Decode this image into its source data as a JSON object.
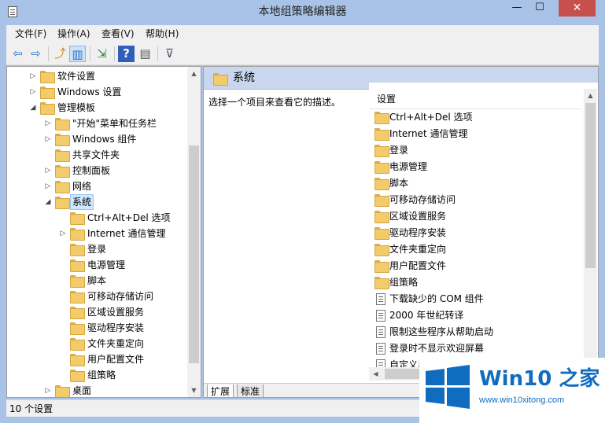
{
  "window": {
    "title": "本地组策略编辑器",
    "min_glyph": "—",
    "max_glyph": "☐",
    "close_glyph": "✕"
  },
  "menu": [
    "文件(F)",
    "操作(A)",
    "查看(V)",
    "帮助(H)"
  ],
  "toolbar": {
    "icons": [
      "back-arrow-icon",
      "forward-arrow-icon",
      "up-folder-icon",
      "show-hide-tree-icon",
      "export-list-icon",
      "help-icon",
      "properties-pane-icon",
      "filter-icon"
    ],
    "glyphs": [
      "⇦",
      "⇨",
      "⤴",
      "▥",
      "⇲",
      "?",
      "▤",
      "⊽"
    ]
  },
  "tree": {
    "items": [
      {
        "label": "软件设置",
        "expander": "▷"
      },
      {
        "label": "Windows 设置",
        "expander": "▷"
      },
      {
        "label": "管理模板",
        "expander": "◢"
      },
      {
        "label": "\"开始\"菜单和任务栏",
        "expander": "▷"
      },
      {
        "label": "Windows 组件",
        "expander": "▷"
      },
      {
        "label": "共享文件夹",
        "expander": ""
      },
      {
        "label": "控制面板",
        "expander": "▷"
      },
      {
        "label": "网络",
        "expander": "▷"
      },
      {
        "label": "系统",
        "expander": "◢"
      },
      {
        "label": "Ctrl+Alt+Del 选项",
        "expander": ""
      },
      {
        "label": "Internet 通信管理",
        "expander": "▷"
      },
      {
        "label": "登录",
        "expander": ""
      },
      {
        "label": "电源管理",
        "expander": ""
      },
      {
        "label": "脚本",
        "expander": ""
      },
      {
        "label": "可移动存储访问",
        "expander": ""
      },
      {
        "label": "区域设置服务",
        "expander": ""
      },
      {
        "label": "驱动程序安装",
        "expander": ""
      },
      {
        "label": "文件夹重定向",
        "expander": ""
      },
      {
        "label": "用户配置文件",
        "expander": ""
      },
      {
        "label": "组策略",
        "expander": ""
      },
      {
        "label": "桌面",
        "expander": "▷"
      }
    ],
    "selected": "系统"
  },
  "scroll": {
    "up": "▲",
    "down": "▼",
    "left": "◀",
    "right": "▶"
  },
  "details": {
    "title": "系统",
    "description": "选择一个项目来查看它的描述。",
    "column_header": "设置",
    "folders": [
      "Ctrl+Alt+Del 选项",
      "Internet 通信管理",
      "登录",
      "电源管理",
      "脚本",
      "可移动存储访问",
      "区域设置服务",
      "驱动程序安装",
      "文件夹重定向",
      "用户配置文件",
      "组策略"
    ],
    "settings": [
      "下载缺少的 COM 组件",
      "2000 年世纪转译",
      "限制这些程序从帮助启动",
      "登录时不显示欢迎屏幕",
      "自定义用"
    ]
  },
  "tabs": [
    "扩展",
    "标准"
  ],
  "status": {
    "text": "10 个设置"
  },
  "watermark": {
    "brand": "Win10 之家",
    "url": "www.win10xitong.com"
  },
  "colors": {
    "title_bg": "#a9c3e8",
    "close_btn": "#c7504c",
    "selection": "#cde8ff",
    "brand_blue": "#0f6cbf"
  }
}
